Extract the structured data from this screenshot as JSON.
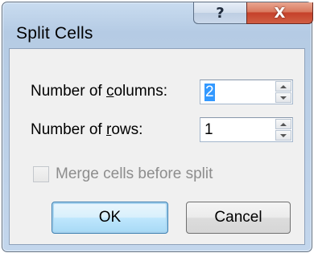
{
  "dialog": {
    "title": "Split Cells",
    "help_glyph": "?",
    "close_glyph": "X"
  },
  "fields": {
    "columns": {
      "label_pre": "Number of ",
      "label_accel": "c",
      "label_post": "olumns:",
      "value": "2"
    },
    "rows": {
      "label_pre": "Number of ",
      "label_accel": "r",
      "label_post": "ows:",
      "value": "1"
    }
  },
  "merge_checkbox": {
    "label": "Merge cells before split",
    "checked": false,
    "enabled": false
  },
  "buttons": {
    "ok": "OK",
    "cancel": "Cancel"
  },
  "icons": {
    "help": "help-icon",
    "close": "close-icon",
    "spin_up": "arrow-up-icon",
    "spin_down": "arrow-down-icon"
  },
  "colors": {
    "title_bar": "#c3d6ec",
    "close_button": "#c5412a",
    "selection": "#3399ff",
    "ok_button_border": "#3c7fb1",
    "disabled_text": "#8d8d8d"
  }
}
